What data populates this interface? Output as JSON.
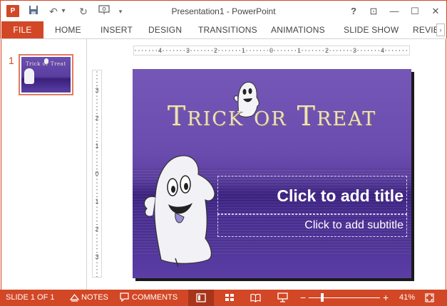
{
  "titlebar": {
    "app_icon_label": "P",
    "title": "Presentation1 - PowerPoint",
    "help": "?",
    "ribbon_display": "⊡",
    "minimize": "—",
    "maximize": "☐",
    "close": "✕"
  },
  "qat": {
    "save": "💾",
    "undo": "↶",
    "undo_dropdown": "▾",
    "redo": "↻",
    "present": "⊞",
    "customize": "▾"
  },
  "tabs": {
    "file": "FILE",
    "home": "HOME",
    "insert": "INSERT",
    "design": "DESIGN",
    "transitions": "TRANSITIONS",
    "animations": "ANIMATIONS",
    "slide_show": "SLIDE SHOW",
    "review": "REVIEW",
    "scroll": "›"
  },
  "thumbnails": {
    "slide_number": "1",
    "thumb_title": "Trick or Treat"
  },
  "rulers": {
    "horizontal": [
      "4",
      "3",
      "2",
      "1",
      "0",
      "1",
      "2",
      "3",
      "4"
    ],
    "vertical": [
      "3",
      "2",
      "1",
      "0",
      "1",
      "2",
      "3"
    ]
  },
  "slide": {
    "banner": "Trick or Treat",
    "title_placeholder": "Click to add title",
    "subtitle_placeholder": "Click to add subtitle",
    "background_color": "#6a4cae"
  },
  "statusbar": {
    "slide_counter": "SLIDE 1 OF 1",
    "notes": "NOTES",
    "comments": "COMMENTS",
    "zoom_out": "−",
    "zoom_in": "+",
    "zoom_level": "41%",
    "zoom_fraction": 0.41,
    "accent_color": "#d24726"
  }
}
